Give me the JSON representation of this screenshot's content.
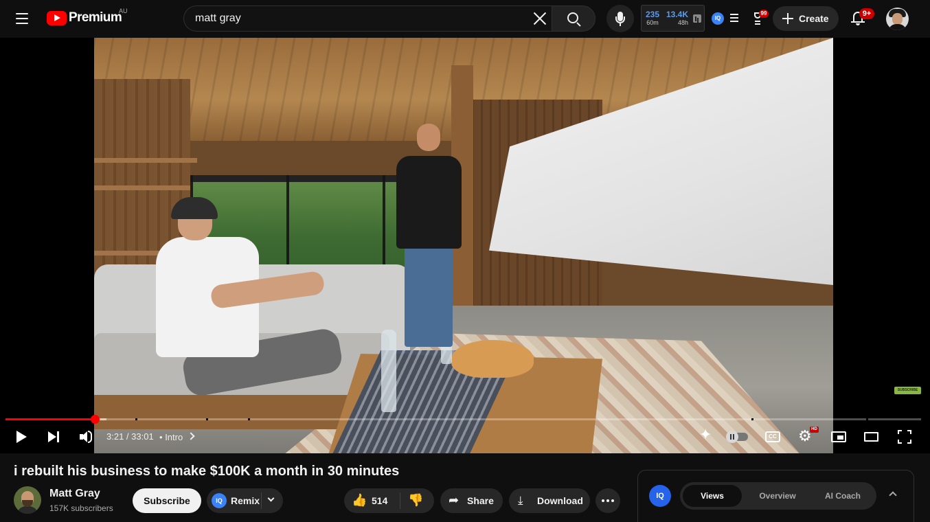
{
  "header": {
    "logo_text": "Premium",
    "country": "AU",
    "search_value": "matt gray",
    "search_placeholder": "Search",
    "create_label": "Create",
    "notification_count": "9+"
  },
  "vidiq_stats": {
    "views_60m": "235",
    "label_60m": "60m",
    "views_48h": "13.4K",
    "label_48h": "48h",
    "iq_label": "IQ",
    "alert_count": "99"
  },
  "player": {
    "progress_fraction": 0.0973,
    "buffered_fraction": 0.11,
    "chapter_gaps": [
      0.142,
      0.219,
      0.265,
      0.815,
      0.94
    ],
    "time_current": "3:21",
    "time_total": "33:01",
    "time_display": "3:21 / 33:01",
    "chapter_separator": "•",
    "chapter_label": "Intro",
    "hd_badge": "HD",
    "cc_label": "CC"
  },
  "video": {
    "title": "i rebuilt his business to make $100K a month in 30 minutes",
    "channel_name": "Matt Gray",
    "subscribers": "157K subscribers",
    "subscribe_label": "Subscribe",
    "remix_label": "Remix",
    "like_count": "514",
    "share_label": "Share",
    "download_label": "Download"
  },
  "vidiq_panel": {
    "logo": "IQ",
    "tabs": [
      {
        "label": "Views",
        "active": true
      },
      {
        "label": "Overview",
        "active": false
      },
      {
        "label": "AI Coach",
        "active": false
      }
    ]
  },
  "icons": {
    "menu": "hamburger-icon",
    "search": "search-icon",
    "clear": "close-icon",
    "mic": "microphone-icon",
    "create": "plus-icon",
    "notifications": "bell-icon",
    "like": "thumbs-up-icon",
    "dislike": "thumbs-down-icon",
    "share": "share-arrow-icon",
    "download": "download-icon",
    "more": "more-horizontal-icon"
  },
  "colors": {
    "brand_red": "#ff0000",
    "background": "#0f0f0f",
    "vidiq_blue": "#3b82f6"
  }
}
